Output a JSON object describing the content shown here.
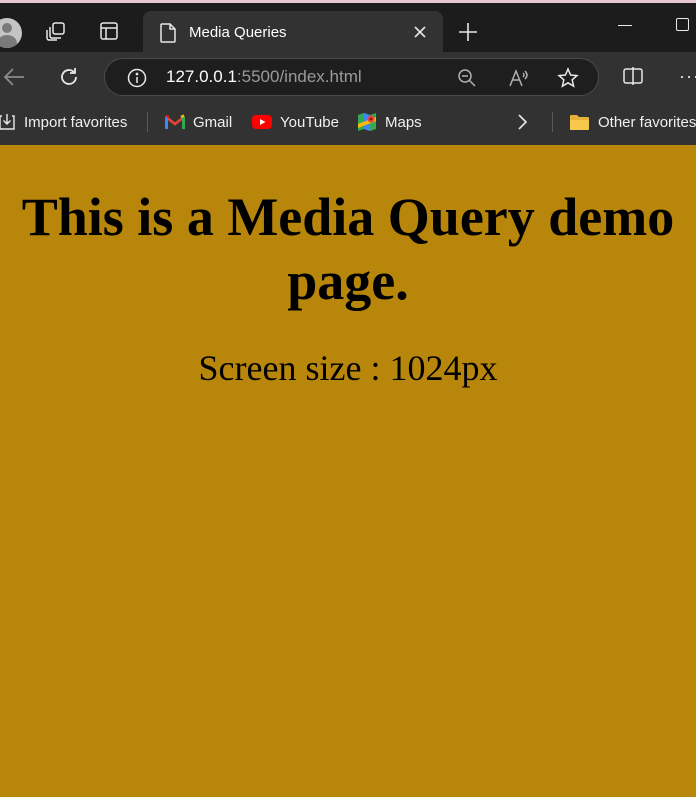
{
  "browser": {
    "tab_title": "Media Queries",
    "url_host": "127.0.0.1",
    "url_rest": ":5500/index.html",
    "more_label": "···"
  },
  "favorites": {
    "import_label": "Import favorites",
    "items": [
      {
        "label": "Gmail",
        "icon": "gmail-icon"
      },
      {
        "label": "YouTube",
        "icon": "youtube-icon"
      },
      {
        "label": "Maps",
        "icon": "maps-icon"
      }
    ],
    "other_label": "Other favorites"
  },
  "page": {
    "heading": "This is a Media Query demo page.",
    "screen_size_text": "Screen size : 1024px",
    "background_color": "#b8860b"
  }
}
